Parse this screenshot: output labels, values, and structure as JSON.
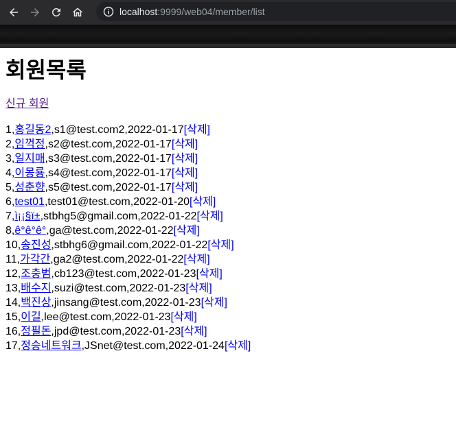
{
  "browser": {
    "url_host": "localhost",
    "url_rest": ":9999/web04/member/list"
  },
  "page": {
    "title": "회원목록",
    "new_member_link": "신규 회원",
    "delete_label": "[삭제]"
  },
  "members": [
    {
      "no": "1",
      "name": "홍길동2",
      "email": "s1@test.com2",
      "date": "2022-01-17"
    },
    {
      "no": "2",
      "name": "임꺽정",
      "email": "s2@test.com",
      "date": "2022-01-17"
    },
    {
      "no": "3",
      "name": "일지매",
      "email": "s3@test.com",
      "date": "2022-01-17"
    },
    {
      "no": "4",
      "name": "이몽룡",
      "email": "s4@test.com",
      "date": "2022-01-17"
    },
    {
      "no": "5",
      "name": "성춘향",
      "email": "s5@test.com",
      "date": "2022-01-17"
    },
    {
      "no": "6",
      "name": "test01",
      "email": "test01@test.com",
      "date": "2022-01-20"
    },
    {
      "no": "7",
      "name": "ì¡¡§ï±",
      "email": "stbhg5@gmail.com",
      "date": "2022-01-22"
    },
    {
      "no": "8",
      "name": "ê°ê°ê°",
      "email": "ga@test.com",
      "date": "2022-01-22"
    },
    {
      "no": "10",
      "name": "송진성",
      "email": "stbhg6@gmail.com",
      "date": "2022-01-22"
    },
    {
      "no": "11",
      "name": "가각간",
      "email": "ga2@test.com",
      "date": "2022-01-22"
    },
    {
      "no": "12",
      "name": "조충범",
      "email": "cb123@test.com",
      "date": "2022-01-23"
    },
    {
      "no": "13",
      "name": "배수지",
      "email": "suzi@test.com",
      "date": "2022-01-23"
    },
    {
      "no": "14",
      "name": "백진상",
      "email": "jinsang@test.com",
      "date": "2022-01-23"
    },
    {
      "no": "15",
      "name": "이길",
      "email": "lee@test.com",
      "date": "2022-01-23"
    },
    {
      "no": "16",
      "name": "정필돈",
      "email": "jpd@test.com",
      "date": "2022-01-23"
    },
    {
      "no": "17",
      "name": "정승네트워크",
      "email": "JSnet@test.com",
      "date": "2022-01-24"
    }
  ]
}
